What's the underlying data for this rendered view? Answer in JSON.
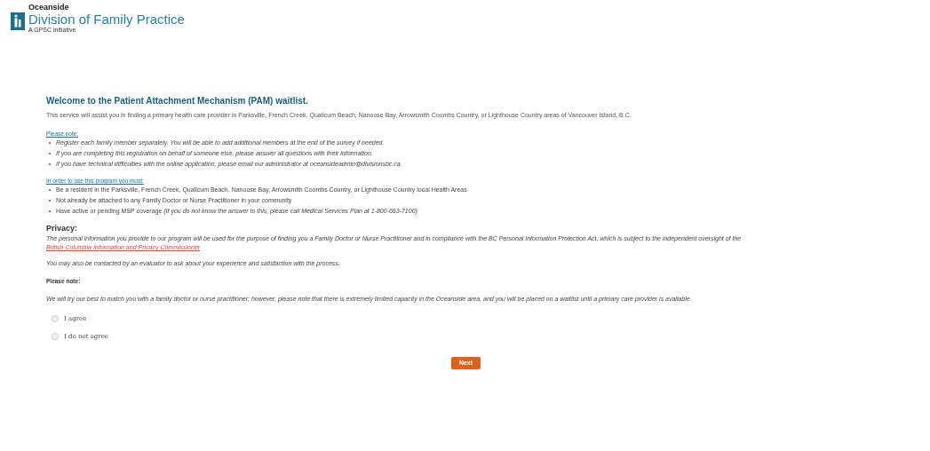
{
  "header": {
    "org_small": "Oceanside",
    "org_name": "Division of Family Practice",
    "tagline": "A GPSC initiative"
  },
  "welcome": {
    "title": "Welcome to the Patient Attachment Mechanism (PAM) waitlist.",
    "intro": "This service will assist you in finding a primary health care provider in Parksville, French Creek, Qualicum Beach, Nanoose Bay, Arrowsmith Coombs Country, or Lighthouse Country areas of Vancouver Island, B.C."
  },
  "note": {
    "heading": "Please note:",
    "items": [
      "Register each family member separately. You will be able to add additional members at the end of the survey if needed.",
      "If you are completing this registration on behalf of someone else, please answer all questions with their information.",
      "If you have technical difficulties with the online application, please email our administrator at oceansideadmin@divisionsbc.ca"
    ]
  },
  "requirements": {
    "heading": "In order to use this program you must:",
    "items": [
      "Be a resident in the Parksville, French Creek, Qualicum Beach, Nanoose Bay, Arrowsmith Coombs Country, or Lighthouse Country local Health Areas",
      "Not already be attached to any Family Doctor or Nurse Practitioner in your community",
      "Have active or pending MSP coverage *(If you do not know the answer to this, please call Medical Services Plan at 1-800-663-7100)*"
    ]
  },
  "privacy": {
    "heading": "Privacy:",
    "text": "The personal information you provide to our program will be used for the purpose of finding you a Family Doctor or Nurse Practitioner and in compliance with the BC Personal Information Protection Act, which is subject to the independent oversight of the",
    "link": "British Columbia Information and Privacy Commissioner",
    "contact_note": "You may also be contacted by an evaluator to ask about your experience and satisfaction with the process."
  },
  "capacity": {
    "heading": "Please note:",
    "text": "We will try our best to match you with a family doctor or nurse practitioner; however, please note that there is extremely limited capacity in the Oceanside area, and you will be placed on a waitlist until a primary care provider is available."
  },
  "options": [
    {
      "label": "I agree",
      "selected": false
    },
    {
      "label": "I do not agree",
      "selected": false
    }
  ],
  "next_button": "Next"
}
